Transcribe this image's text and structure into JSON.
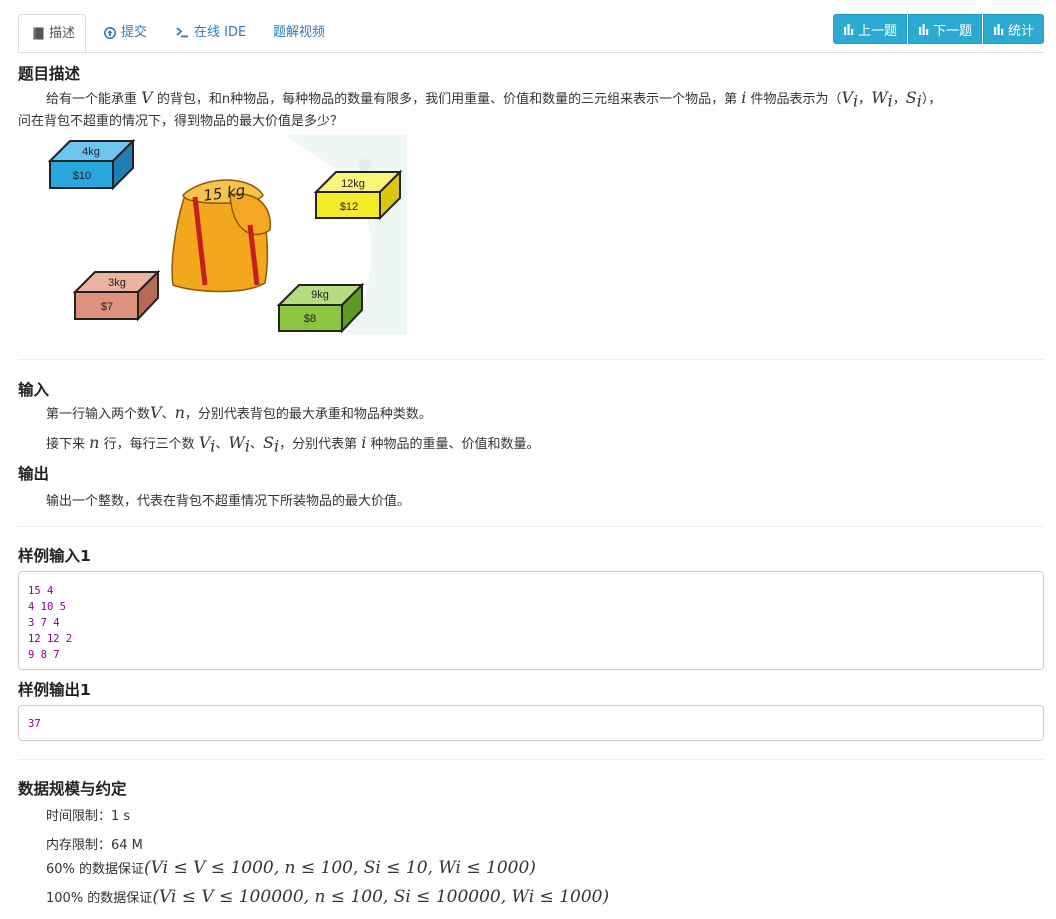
{
  "tabs": [
    {
      "label": "描述",
      "icon": "book-icon",
      "active": true
    },
    {
      "label": "提交",
      "icon": "upload-circle-icon",
      "active": false
    },
    {
      "label": "在线 IDE",
      "icon": "terminal-icon",
      "active": false
    },
    {
      "label": "题解视频",
      "icon": "",
      "active": false
    }
  ],
  "nav_buttons": [
    {
      "label": "上一题",
      "icon": "bar-chart-icon"
    },
    {
      "label": "下一题",
      "icon": "bar-chart-icon"
    },
    {
      "label": "统计",
      "icon": "bar-chart-icon"
    }
  ],
  "description": {
    "heading": "题目描述",
    "line1_a": "给有一个能承重 ",
    "line1_V": "V",
    "line1_b": " 的背包，和n种物品，每种物品的数量有限多，我们用重量、价值和数量的三元组来表示一个物品，第 ",
    "line1_i": "i",
    "line1_c": " 件物品表示为（",
    "line1_Vi": "V",
    "line1_Wi": "W",
    "line1_Si": "S",
    "sub_i": "i",
    "sep": "，",
    "line1_d": "），",
    "line2": "问在背包不超重的情况下，得到物品的最大价值是多少？"
  },
  "illustration": {
    "bag_label": "15 kg",
    "items": [
      {
        "weight": "4kg",
        "price": "$10",
        "color": "#29a8e0"
      },
      {
        "weight": "12kg",
        "price": "$12",
        "color": "#f5ea28"
      },
      {
        "weight": "3kg",
        "price": "$7",
        "color": "#e0937c"
      },
      {
        "weight": "9kg",
        "price": "$8",
        "color": "#8cc63f"
      }
    ]
  },
  "input": {
    "heading": "输入",
    "line1_a": "第一行输入两个数",
    "line1_V": "V",
    "line1_sep": "、",
    "line1_n": "n",
    "line1_b": "，分别代表背包的最大承重和物品种类数。",
    "line2_a": "接下来 ",
    "line2_n": "n",
    "line2_b": " 行，每行三个数 ",
    "line2_c": "，分别代表第 ",
    "line2_i": "i",
    "line2_d": " 种物品的重量、价值和数量。",
    "sep": "、"
  },
  "output": {
    "heading": "输出",
    "line": "输出一个整数，代表在背包不超重情况下所装物品的最大价值。"
  },
  "sample_input": {
    "heading": "样例输入1",
    "lines": [
      "15 4",
      "4 10 5",
      "3 7 4",
      "12 12 2",
      "9 8 7"
    ]
  },
  "sample_output": {
    "heading": "样例输出1",
    "lines": [
      "37"
    ]
  },
  "constraints": {
    "heading": "数据规模与约定",
    "time": "时间限制：1 s",
    "memory": "内存限制：64 M",
    "c60_prefix": "60% 的数据保证",
    "c60_math": "(Vi ≤ V ≤ 1000, n ≤ 100, Si ≤ 10, Wi ≤ 1000)",
    "c100_prefix": "100% 的数据保证",
    "c100_math": "(Vi ≤ V ≤ 100000, n ≤ 100, Si ≤ 100000, Wi ≤ 1000)"
  }
}
